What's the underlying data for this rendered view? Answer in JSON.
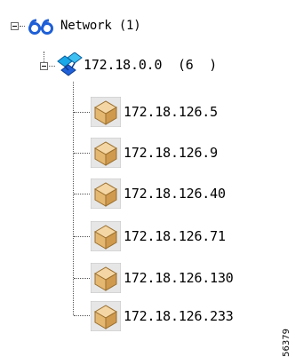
{
  "tree": {
    "root": {
      "label": "Network (1)",
      "icon": "network-binoculars-icon",
      "expanded": true
    },
    "subnet": {
      "label": "172.18.0.0  (6  )",
      "icon": "subnet-icon",
      "expanded": true
    },
    "hosts": [
      {
        "label": "172.18.126.5",
        "icon": "device-box-icon"
      },
      {
        "label": "172.18.126.9",
        "icon": "device-box-icon"
      },
      {
        "label": "172.18.126.40",
        "icon": "device-box-icon"
      },
      {
        "label": "172.18.126.71",
        "icon": "device-box-icon"
      },
      {
        "label": "172.18.126.130",
        "icon": "device-box-icon"
      },
      {
        "label": "172.18.126.233",
        "icon": "device-box-icon"
      }
    ]
  },
  "figure_id": "56379"
}
